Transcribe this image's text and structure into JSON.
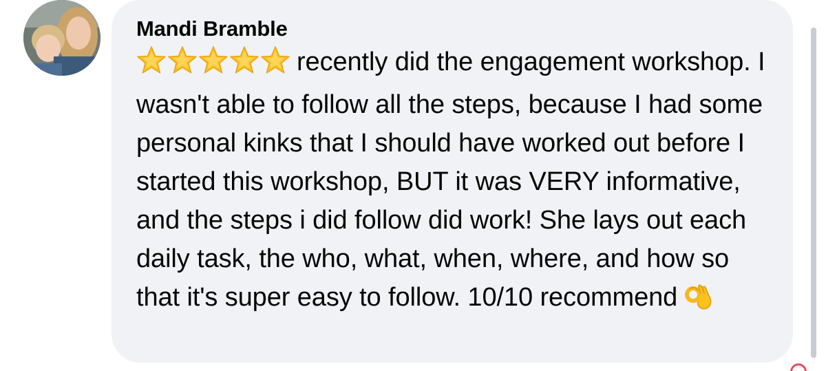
{
  "comment": {
    "author": "Mandi Bramble",
    "rating_stars": 5,
    "text": "recently did the engagement workshop. I wasn't able to follow all the steps, because I had some personal kinks that I should have worked out before I started this workshop, BUT it was VERY informative, and the steps i did follow did work! She lays out each daily task, the who, what, when, where, and how so that it's super easy to follow. 10/10 recommend",
    "trailing_emoji": "ok-hand-emoji"
  },
  "icons": {
    "star": "star-emoji",
    "ok": "ok-hand-emoji"
  },
  "colors": {
    "bubble_bg": "#f0f2f5",
    "text": "#050505",
    "star_fill": "#fcc21b",
    "scrollbar": "#c9ccd1"
  }
}
